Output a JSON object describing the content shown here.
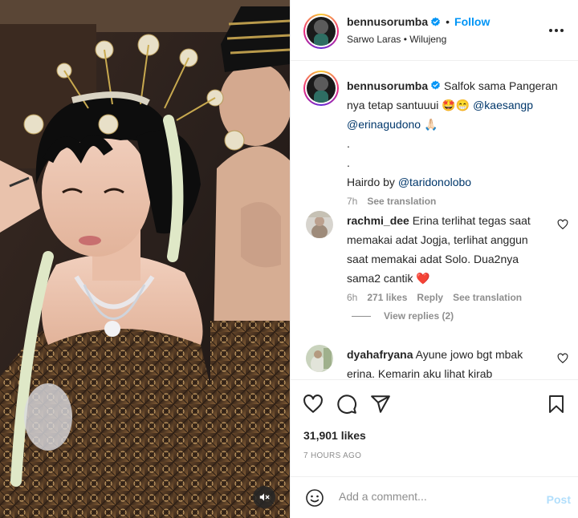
{
  "header": {
    "username": "bennusorumba",
    "dot": "•",
    "follow_label": "Follow",
    "subtitle": "Sarwo Laras • Wilujeng"
  },
  "caption": {
    "username": "bennusorumba",
    "text_1": "Salfok sama Pangeran nya tetap santuuui 🤩😁",
    "mention_1": "@kaesangp",
    "mention_2": "@erinagudono",
    "text_2": "🙏🏻",
    "dot_1": ".",
    "dot_2": ".",
    "hairdo_prefix": "Hairdo by",
    "mention_3": "@taridonolobo",
    "time": "7h",
    "see_translation": "See translation"
  },
  "comments": [
    {
      "username": "rachmi_dee",
      "text": "Erina terlihat tegas saat memakai adat Jogja, terlihat anggun saat memakai adat Solo. Dua2nya sama2 cantik ❤️",
      "time": "6h",
      "likes": "271 likes",
      "reply": "Reply",
      "see_translation": "See translation",
      "view_replies": "View replies (2)"
    },
    {
      "username": "dyahafryana",
      "text": "Ayune jowo bgt mbak erina. Kemarin aku lihat kirab"
    }
  ],
  "actions": {
    "likes": "31,901 likes",
    "time_ago": "7 HOURS AGO"
  },
  "add_comment": {
    "placeholder": "Add a comment...",
    "post_label": "Post"
  },
  "colors": {
    "accent": "#0095f6",
    "mention": "#00376b",
    "muted": "#8e8e8e",
    "post_disabled": "#b2dffc",
    "heart_red": "#ed1c43"
  },
  "icons": [
    "verified-badge-icon",
    "more-options-icon",
    "heart-icon",
    "comment-icon",
    "share-icon",
    "bookmark-icon",
    "emoji-icon",
    "mute-icon"
  ]
}
